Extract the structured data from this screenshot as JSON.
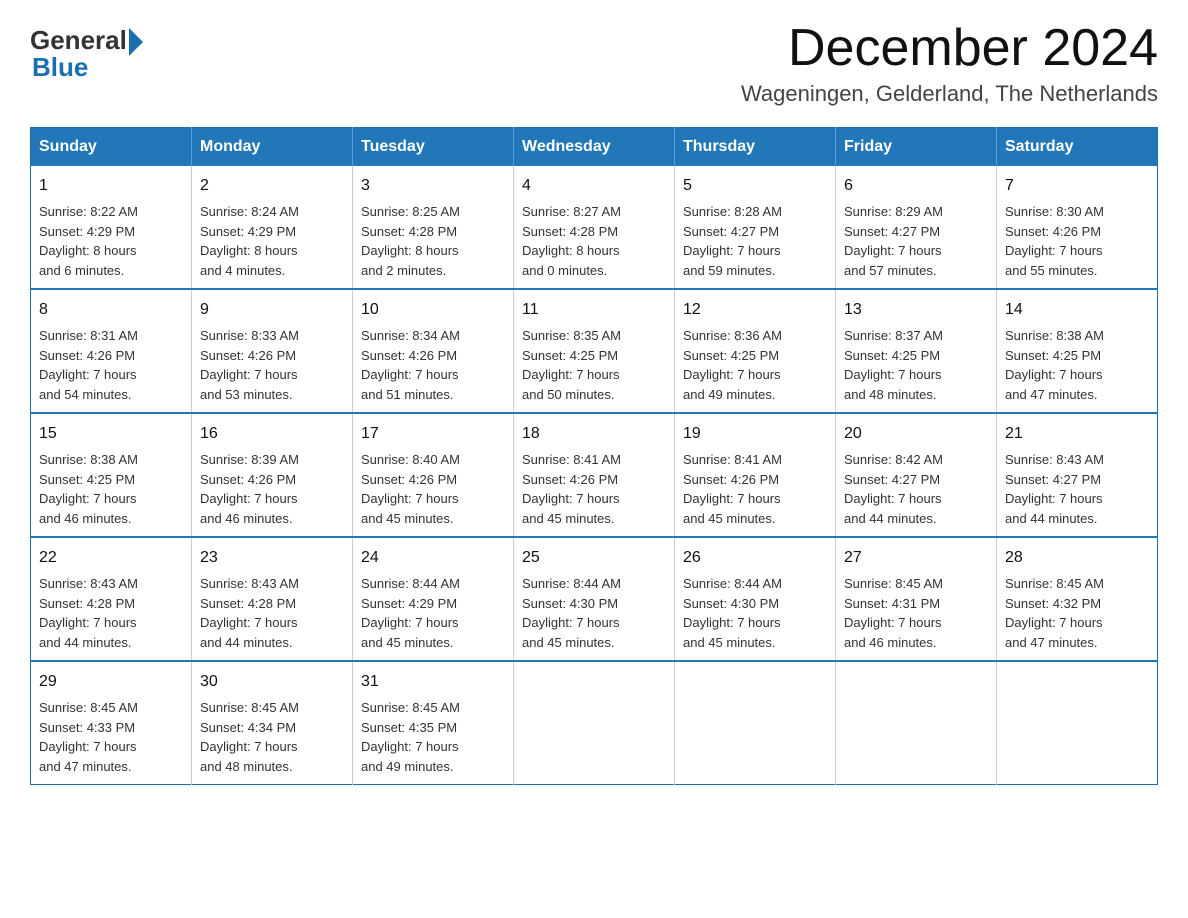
{
  "logo": {
    "general": "General",
    "blue": "Blue"
  },
  "title": {
    "month": "December 2024",
    "location": "Wageningen, Gelderland, The Netherlands"
  },
  "days_of_week": [
    "Sunday",
    "Monday",
    "Tuesday",
    "Wednesday",
    "Thursday",
    "Friday",
    "Saturday"
  ],
  "weeks": [
    [
      {
        "day": "1",
        "sunrise": "8:22 AM",
        "sunset": "4:29 PM",
        "daylight_hours": "8",
        "daylight_minutes": "6"
      },
      {
        "day": "2",
        "sunrise": "8:24 AM",
        "sunset": "4:29 PM",
        "daylight_hours": "8",
        "daylight_minutes": "4"
      },
      {
        "day": "3",
        "sunrise": "8:25 AM",
        "sunset": "4:28 PM",
        "daylight_hours": "8",
        "daylight_minutes": "2"
      },
      {
        "day": "4",
        "sunrise": "8:27 AM",
        "sunset": "4:28 PM",
        "daylight_hours": "8",
        "daylight_minutes": "0"
      },
      {
        "day": "5",
        "sunrise": "8:28 AM",
        "sunset": "4:27 PM",
        "daylight_hours": "7",
        "daylight_minutes": "59"
      },
      {
        "day": "6",
        "sunrise": "8:29 AM",
        "sunset": "4:27 PM",
        "daylight_hours": "7",
        "daylight_minutes": "57"
      },
      {
        "day": "7",
        "sunrise": "8:30 AM",
        "sunset": "4:26 PM",
        "daylight_hours": "7",
        "daylight_minutes": "55"
      }
    ],
    [
      {
        "day": "8",
        "sunrise": "8:31 AM",
        "sunset": "4:26 PM",
        "daylight_hours": "7",
        "daylight_minutes": "54"
      },
      {
        "day": "9",
        "sunrise": "8:33 AM",
        "sunset": "4:26 PM",
        "daylight_hours": "7",
        "daylight_minutes": "53"
      },
      {
        "day": "10",
        "sunrise": "8:34 AM",
        "sunset": "4:26 PM",
        "daylight_hours": "7",
        "daylight_minutes": "51"
      },
      {
        "day": "11",
        "sunrise": "8:35 AM",
        "sunset": "4:25 PM",
        "daylight_hours": "7",
        "daylight_minutes": "50"
      },
      {
        "day": "12",
        "sunrise": "8:36 AM",
        "sunset": "4:25 PM",
        "daylight_hours": "7",
        "daylight_minutes": "49"
      },
      {
        "day": "13",
        "sunrise": "8:37 AM",
        "sunset": "4:25 PM",
        "daylight_hours": "7",
        "daylight_minutes": "48"
      },
      {
        "day": "14",
        "sunrise": "8:38 AM",
        "sunset": "4:25 PM",
        "daylight_hours": "7",
        "daylight_minutes": "47"
      }
    ],
    [
      {
        "day": "15",
        "sunrise": "8:38 AM",
        "sunset": "4:25 PM",
        "daylight_hours": "7",
        "daylight_minutes": "46"
      },
      {
        "day": "16",
        "sunrise": "8:39 AM",
        "sunset": "4:26 PM",
        "daylight_hours": "7",
        "daylight_minutes": "46"
      },
      {
        "day": "17",
        "sunrise": "8:40 AM",
        "sunset": "4:26 PM",
        "daylight_hours": "7",
        "daylight_minutes": "45"
      },
      {
        "day": "18",
        "sunrise": "8:41 AM",
        "sunset": "4:26 PM",
        "daylight_hours": "7",
        "daylight_minutes": "45"
      },
      {
        "day": "19",
        "sunrise": "8:41 AM",
        "sunset": "4:26 PM",
        "daylight_hours": "7",
        "daylight_minutes": "45"
      },
      {
        "day": "20",
        "sunrise": "8:42 AM",
        "sunset": "4:27 PM",
        "daylight_hours": "7",
        "daylight_minutes": "44"
      },
      {
        "day": "21",
        "sunrise": "8:43 AM",
        "sunset": "4:27 PM",
        "daylight_hours": "7",
        "daylight_minutes": "44"
      }
    ],
    [
      {
        "day": "22",
        "sunrise": "8:43 AM",
        "sunset": "4:28 PM",
        "daylight_hours": "7",
        "daylight_minutes": "44"
      },
      {
        "day": "23",
        "sunrise": "8:43 AM",
        "sunset": "4:28 PM",
        "daylight_hours": "7",
        "daylight_minutes": "44"
      },
      {
        "day": "24",
        "sunrise": "8:44 AM",
        "sunset": "4:29 PM",
        "daylight_hours": "7",
        "daylight_minutes": "45"
      },
      {
        "day": "25",
        "sunrise": "8:44 AM",
        "sunset": "4:30 PM",
        "daylight_hours": "7",
        "daylight_minutes": "45"
      },
      {
        "day": "26",
        "sunrise": "8:44 AM",
        "sunset": "4:30 PM",
        "daylight_hours": "7",
        "daylight_minutes": "45"
      },
      {
        "day": "27",
        "sunrise": "8:45 AM",
        "sunset": "4:31 PM",
        "daylight_hours": "7",
        "daylight_minutes": "46"
      },
      {
        "day": "28",
        "sunrise": "8:45 AM",
        "sunset": "4:32 PM",
        "daylight_hours": "7",
        "daylight_minutes": "47"
      }
    ],
    [
      {
        "day": "29",
        "sunrise": "8:45 AM",
        "sunset": "4:33 PM",
        "daylight_hours": "7",
        "daylight_minutes": "47"
      },
      {
        "day": "30",
        "sunrise": "8:45 AM",
        "sunset": "4:34 PM",
        "daylight_hours": "7",
        "daylight_minutes": "48"
      },
      {
        "day": "31",
        "sunrise": "8:45 AM",
        "sunset": "4:35 PM",
        "daylight_hours": "7",
        "daylight_minutes": "49"
      },
      null,
      null,
      null,
      null
    ]
  ]
}
